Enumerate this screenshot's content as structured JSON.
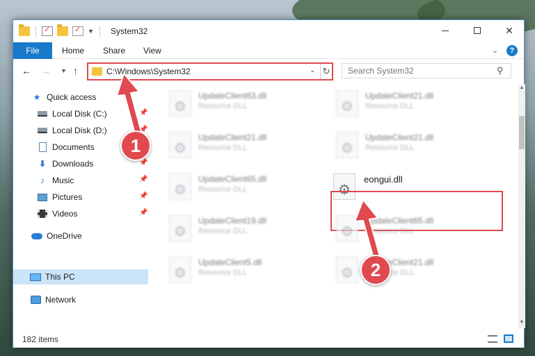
{
  "window": {
    "title": "System32",
    "controls": {
      "minimize": "minimize",
      "maximize": "maximize",
      "close": "✕"
    }
  },
  "ribbon": {
    "tabs": [
      "File",
      "Home",
      "Share",
      "View"
    ],
    "help": "?"
  },
  "navbar": {
    "address": "C:\\Windows\\System32",
    "search_placeholder": "Search System32"
  },
  "sidebar": {
    "items": [
      {
        "label": "Quick access",
        "icon": "star-icon",
        "pinned": false
      },
      {
        "label": "Local Disk (C:)",
        "icon": "drive-icon",
        "pinned": true
      },
      {
        "label": "Local Disk (D:)",
        "icon": "drive-icon",
        "pinned": true
      },
      {
        "label": "Documents",
        "icon": "document-icon",
        "pinned": true
      },
      {
        "label": "Downloads",
        "icon": "download-icon",
        "pinned": true
      },
      {
        "label": "Music",
        "icon": "music-icon",
        "pinned": true
      },
      {
        "label": "Pictures",
        "icon": "pictures-icon",
        "pinned": true
      },
      {
        "label": "Videos",
        "icon": "videos-icon",
        "pinned": true
      },
      {
        "label": "OneDrive",
        "icon": "onedrive-icon",
        "pinned": false
      },
      {
        "label": "This PC",
        "icon": "this-pc-icon",
        "pinned": false,
        "selected": true
      },
      {
        "label": "Network",
        "icon": "network-icon",
        "pinned": false
      }
    ]
  },
  "files": [
    {
      "name": "UpdateClient63.dll",
      "type": "Resource DLL",
      "blurred": true
    },
    {
      "name": "UpdateClient21.dll",
      "type": "Resource DLL",
      "blurred": true
    },
    {
      "name": "UpdateClient21.dll",
      "type": "Resource DLL",
      "blurred": true
    },
    {
      "name": "UpdateClient21.dll",
      "type": "Resource DLL",
      "blurred": true
    },
    {
      "name": "UpdateClient65.dll",
      "type": "Resource DLL",
      "blurred": true
    },
    {
      "name": "eongui.dll",
      "type": "",
      "blurred": false,
      "highlighted": true
    },
    {
      "name": "UpdateClient19.dll",
      "type": "Resource DLL",
      "blurred": true
    },
    {
      "name": "UpdateClient65.dll",
      "type": "Resource DLL",
      "blurred": true
    },
    {
      "name": "UpdateClient5.dll",
      "type": "Resource DLL",
      "blurred": true
    },
    {
      "name": "UpdateClient21.dll",
      "type": "Resource DLL",
      "blurred": true
    }
  ],
  "status": {
    "item_count": "182 items"
  },
  "annotations": {
    "step1": "1",
    "step2": "2"
  },
  "colors": {
    "accent": "#1979ca",
    "highlight": "#e0494f",
    "selected": "#cce4f7"
  }
}
